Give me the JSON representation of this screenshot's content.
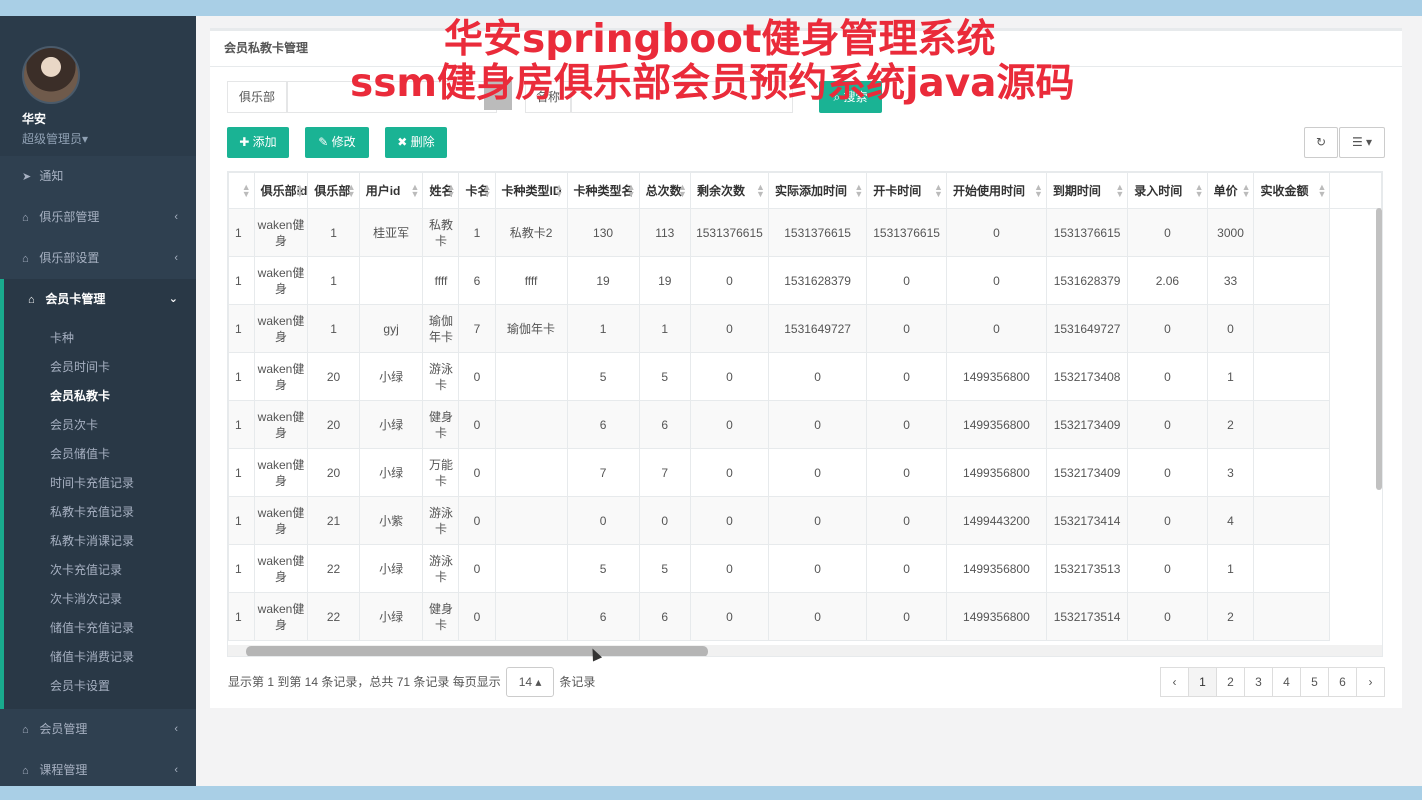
{
  "user": {
    "name": "华安",
    "role": "超级管理员▾"
  },
  "nav": {
    "notify": "通知",
    "club_mgmt": "俱乐部管理",
    "club_settings": "俱乐部设置",
    "card_mgmt": "会员卡管理",
    "sub_items": [
      "卡种",
      "会员时间卡",
      "会员私教卡",
      "会员次卡",
      "会员储值卡",
      "时间卡充值记录",
      "私教卡充值记录",
      "私教卡消课记录",
      "次卡充值记录",
      "次卡消次记录",
      "储值卡充值记录",
      "储值卡消费记录",
      "会员卡设置"
    ],
    "member_mgmt": "会员管理",
    "course_mgmt": "课程管理"
  },
  "panel": {
    "title": "会员私教卡管理"
  },
  "search": {
    "club_label": "俱乐部",
    "name_label": "名称",
    "button": "搜索"
  },
  "toolbar": {
    "add": "✚ 添加",
    "edit": "✎ 修改",
    "delete": "✖ 删除"
  },
  "table": {
    "headers": [
      "",
      "俱乐部id",
      "俱乐部",
      "用户id",
      "姓名",
      "卡名",
      "卡种类型ID",
      "卡种类型名",
      "总次数",
      "剩余次数",
      "实际添加时间",
      "开卡时间",
      "开始使用时间",
      "到期时间",
      "录入时间",
      "单价",
      "实收金额"
    ],
    "rows": [
      [
        "1",
        "waken健身",
        "1",
        "桂亚军",
        "私教卡",
        "1",
        "私教卡2",
        "130",
        "113",
        "1531376615",
        "1531376615",
        "1531376615",
        "0",
        "1531376615",
        "0",
        "3000",
        ""
      ],
      [
        "1",
        "waken健身",
        "1",
        "",
        "ffff",
        "6",
        "ffff",
        "19",
        "19",
        "0",
        "1531628379",
        "0",
        "0",
        "1531628379",
        "2.06",
        "33",
        ""
      ],
      [
        "1",
        "waken健身",
        "1",
        "gyj",
        "瑜伽年卡",
        "7",
        "瑜伽年卡",
        "1",
        "1",
        "0",
        "1531649727",
        "0",
        "0",
        "1531649727",
        "0",
        "0",
        ""
      ],
      [
        "1",
        "waken健身",
        "20",
        "小绿",
        "游泳卡",
        "0",
        "",
        "5",
        "5",
        "0",
        "0",
        "0",
        "1499356800",
        "1532173408",
        "0",
        "1",
        ""
      ],
      [
        "1",
        "waken健身",
        "20",
        "小绿",
        "健身卡",
        "0",
        "",
        "6",
        "6",
        "0",
        "0",
        "0",
        "1499356800",
        "1532173409",
        "0",
        "2",
        ""
      ],
      [
        "1",
        "waken健身",
        "20",
        "小绿",
        "万能卡",
        "0",
        "",
        "7",
        "7",
        "0",
        "0",
        "0",
        "1499356800",
        "1532173409",
        "0",
        "3",
        ""
      ],
      [
        "1",
        "waken健身",
        "21",
        "小紫",
        "游泳卡",
        "0",
        "",
        "0",
        "0",
        "0",
        "0",
        "0",
        "1499443200",
        "1532173414",
        "0",
        "4",
        ""
      ],
      [
        "1",
        "waken健身",
        "22",
        "小绿",
        "游泳卡",
        "0",
        "",
        "5",
        "5",
        "0",
        "0",
        "0",
        "1499356800",
        "1532173513",
        "0",
        "1",
        ""
      ],
      [
        "1",
        "waken健身",
        "22",
        "小绿",
        "健身卡",
        "0",
        "",
        "6",
        "6",
        "0",
        "0",
        "0",
        "1499356800",
        "1532173514",
        "0",
        "2",
        ""
      ]
    ]
  },
  "footer": {
    "info_prefix": "显示第 1 到第 14 条记录，总共 71 条记录 每页显示",
    "page_size": "14 ▴",
    "info_suffix": "条记录"
  },
  "pager": {
    "prev": "‹",
    "pages": [
      "1",
      "2",
      "3",
      "4",
      "5",
      "6"
    ],
    "next": "›"
  },
  "overlay": {
    "line1": "华安springboot健身管理系统",
    "line2": "ssm健身房俱乐部会员预约系统java源码"
  },
  "colors": {
    "sidebar": "#2f4050",
    "accent": "#1ab394",
    "overlay_text": "#ea2b3a"
  }
}
